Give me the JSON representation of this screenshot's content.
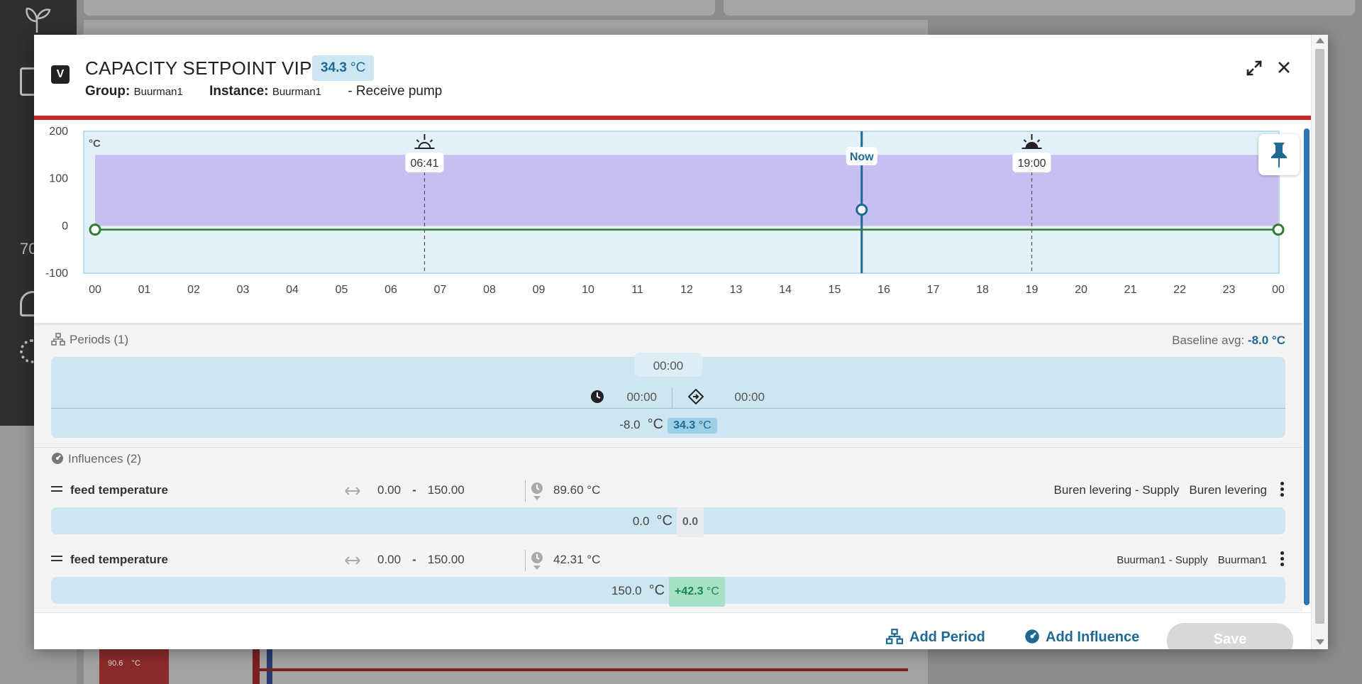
{
  "background": {
    "side_number": "70",
    "panel_value": "90.6",
    "panel_unit": "°C"
  },
  "dialog": {
    "badge": "V",
    "title": "CAPACITY SETPOINT VIP",
    "current_value": "34.3",
    "current_unit": "°C",
    "group_label": "Group:",
    "group_value": "Buurman1",
    "instance_label": "Instance:",
    "instance_value": "Buurman1",
    "description": "- Receive pump"
  },
  "chart_data": {
    "type": "area",
    "y_unit": "°C",
    "ylim": [
      -100,
      200
    ],
    "y_ticks": [
      "200",
      "100",
      "0",
      "-100"
    ],
    "x_ticks": [
      "00",
      "01",
      "02",
      "03",
      "04",
      "05",
      "06",
      "07",
      "08",
      "09",
      "10",
      "11",
      "12",
      "13",
      "14",
      "15",
      "16",
      "17",
      "18",
      "19",
      "20",
      "21",
      "22",
      "23",
      "00"
    ],
    "band": {
      "lower": 0,
      "upper": 150,
      "from_hour": 0,
      "to_hour": 24
    },
    "line": {
      "name": "baseline",
      "points": [
        [
          0,
          -8.0
        ],
        [
          24,
          -8.0
        ]
      ]
    },
    "now_point": {
      "hour": 15.55,
      "value": 34.3
    },
    "markers": [
      {
        "label": "06:41",
        "hour": 6.683,
        "kind": "sunrise"
      },
      {
        "label": "Now",
        "hour": 15.55,
        "kind": "now"
      },
      {
        "label": "19:00",
        "hour": 19.0,
        "kind": "sunset"
      }
    ],
    "colors": {
      "plot_bg": "#e2f1f8",
      "band": "#c8bff1",
      "line": "#2e7d32",
      "now": "#1d6a94"
    }
  },
  "periods": {
    "header": "Periods (1)",
    "baseline_label": "Baseline avg:",
    "baseline_value": "-8.0 °C",
    "tab_label": "00:00",
    "start_time": "00:00",
    "end_time": "00:00",
    "value": "-8.0",
    "unit": "°C",
    "current_value": "34.3",
    "current_unit": "°C"
  },
  "influences": {
    "header": "Influences (2)",
    "items": [
      {
        "name": "feed temperature",
        "min": "0.00",
        "dash": "-",
        "max": "150.00",
        "now": "89.60 °C",
        "source": "Buren levering - Supply",
        "instance": "Buren levering",
        "value": "0.0",
        "unit": "°C",
        "delta": "0.0",
        "delta_unit": ""
      },
      {
        "name": "feed temperature",
        "min": "0.00",
        "dash": "-",
        "max": "150.00",
        "now": "42.31 °C",
        "source": "Buurman1 - Supply",
        "instance": "Buurman1",
        "value": "150.0",
        "unit": "°C",
        "delta": "+42.3",
        "delta_unit": "°C"
      }
    ]
  },
  "footer": {
    "add_period": "Add Period",
    "add_influence": "Add Influence",
    "save": "Save"
  }
}
